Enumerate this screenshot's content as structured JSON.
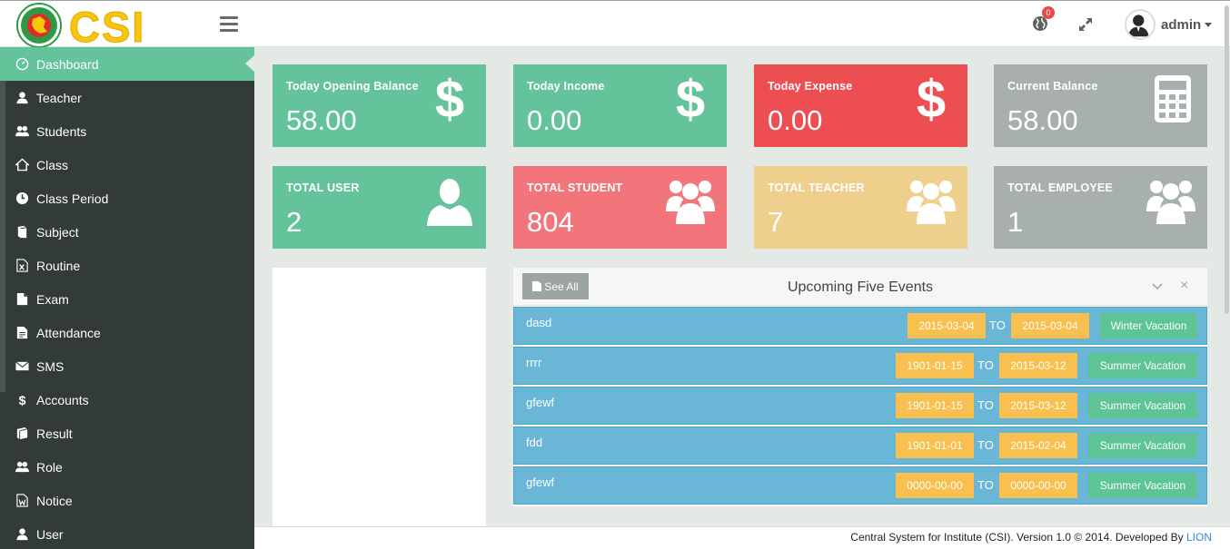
{
  "header": {
    "logo_text": "CSI",
    "notification_count": "0",
    "user_name": "admin"
  },
  "sidebar": {
    "items": [
      {
        "label": "Dashboard",
        "icon": "dashboard-icon",
        "active": true
      },
      {
        "label": "Teacher",
        "icon": "user-icon"
      },
      {
        "label": "Students",
        "icon": "users-icon"
      },
      {
        "label": "Class",
        "icon": "home-icon"
      },
      {
        "label": "Class Period",
        "icon": "clock-icon"
      },
      {
        "label": "Subject",
        "icon": "book-icon"
      },
      {
        "label": "Routine",
        "icon": "excel-file-icon"
      },
      {
        "label": "Exam",
        "icon": "file-icon"
      },
      {
        "label": "Attendance",
        "icon": "file-text-icon"
      },
      {
        "label": "SMS",
        "icon": "envelope-icon"
      },
      {
        "label": "Accounts",
        "icon": "dollar-icon"
      },
      {
        "label": "Result",
        "icon": "book-stack-icon"
      },
      {
        "label": "Role",
        "icon": "users-icon"
      },
      {
        "label": "Notice",
        "icon": "word-file-icon"
      },
      {
        "label": "User",
        "icon": "user-icon"
      }
    ]
  },
  "stats": {
    "opening": {
      "label": "Today Opening Balance",
      "value": "58.00",
      "color": "#64c39a",
      "icon": "dollar-icon"
    },
    "income": {
      "label": "Today Income",
      "value": "0.00",
      "color": "#64c39a",
      "icon": "dollar-icon"
    },
    "expense": {
      "label": "Today Expense",
      "value": "0.00",
      "color": "#ec4e52",
      "icon": "dollar-icon"
    },
    "balance": {
      "label": "Current Balance",
      "value": "58.00",
      "color": "#a8b0ad",
      "icon": "calculator-icon"
    },
    "users": {
      "label": "TOTAL USER",
      "value": "2",
      "color": "#64c39a",
      "icon": "user-icon"
    },
    "students": {
      "label": "TOTAL STUDENT",
      "value": "804",
      "color": "#f3757c",
      "icon": "group-icon"
    },
    "teachers": {
      "label": "TOTAL TEACHER",
      "value": "7",
      "color": "#efcf8c",
      "icon": "group-icon"
    },
    "employees": {
      "label": "TOTAL EMPLOYEE",
      "value": "1",
      "color": "#a8b0ad",
      "icon": "group-icon"
    }
  },
  "events": {
    "title": "Upcoming Five Events",
    "see_all_label": "See All",
    "to_label": "TO",
    "rows": [
      {
        "name": "dasd",
        "start": "2015-03-04",
        "end": "2015-03-04",
        "type": "Winter Vacation"
      },
      {
        "name": "rrrr",
        "start": "1901-01-15",
        "end": "2015-03-12",
        "type": "Summer Vacation"
      },
      {
        "name": "gfewf",
        "start": "1901-01-15",
        "end": "2015-03-12",
        "type": "Summer Vacation"
      },
      {
        "name": "fdd",
        "start": "1901-01-01",
        "end": "2015-02-04",
        "type": "Summer Vacation"
      },
      {
        "name": "gfewf",
        "start": "0000-00-00",
        "end": "0000-00-00",
        "type": "Summer Vacation"
      }
    ]
  },
  "footer": {
    "text": "Central System for Institute (CSI). Version 1.0 © 2014. Developed By",
    "link": "LION"
  }
}
